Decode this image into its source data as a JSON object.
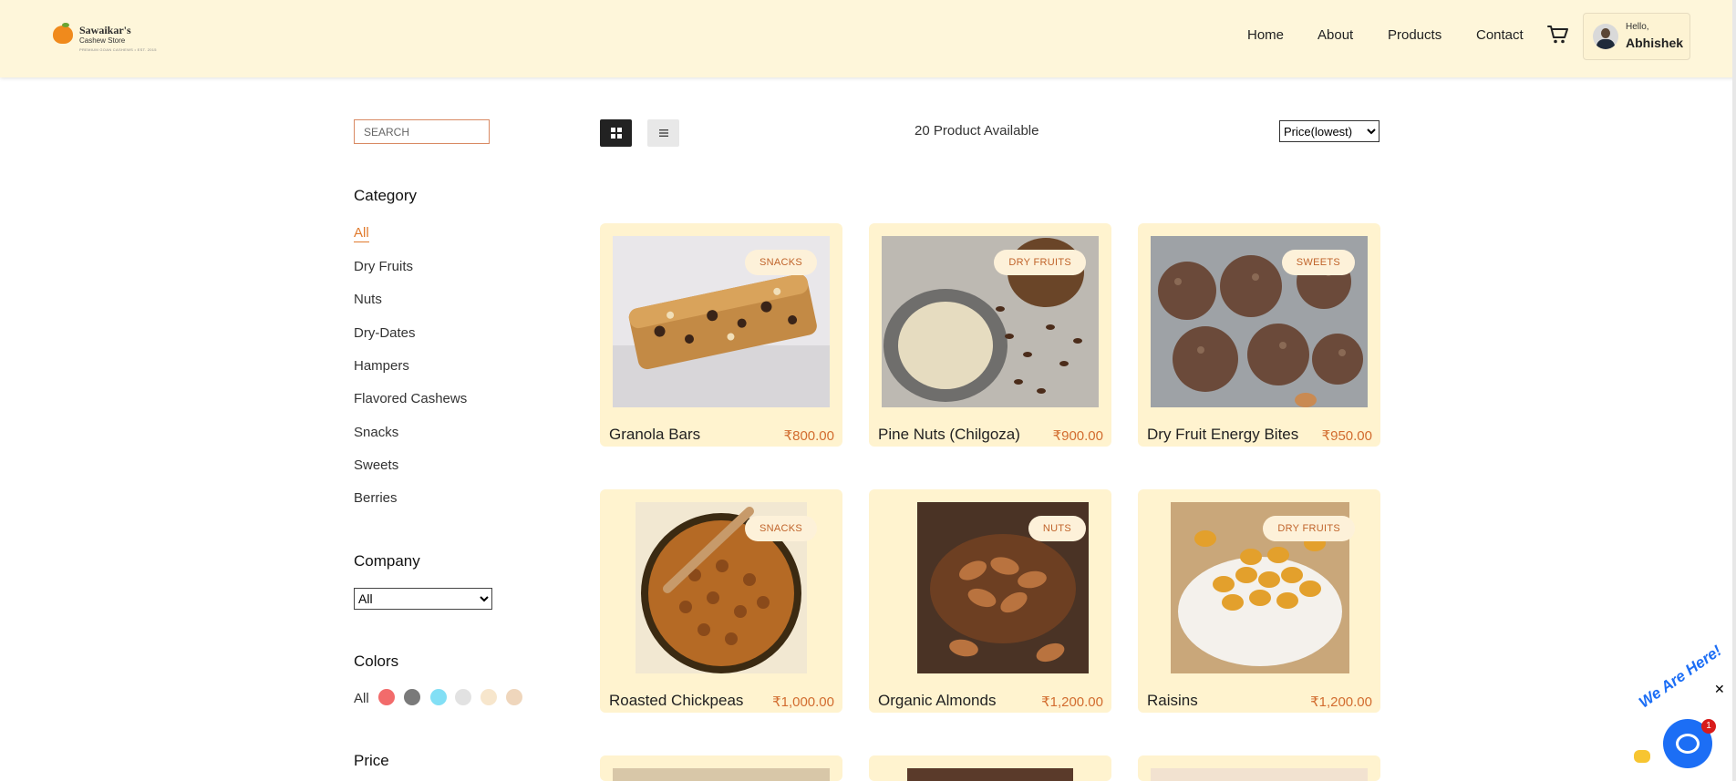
{
  "brand": {
    "name": "Sawaikar's",
    "sub": "Cashew Store",
    "tagline": "PREMIUM GOAN CASHEWS • EST. 2015"
  },
  "nav": {
    "home": "Home",
    "about": "About",
    "products": "Products",
    "contact": "Contact"
  },
  "user": {
    "greeting": "Hello,",
    "name": "Abhishek"
  },
  "filters": {
    "search_placeholder": "SEARCH",
    "category_title": "Category",
    "categories": [
      "All",
      "Dry Fruits",
      "Nuts",
      "Dry-Dates",
      "Hampers",
      "Flavored Cashews",
      "Snacks",
      "Sweets",
      "Berries"
    ],
    "company_title": "Company",
    "company_selected": "All",
    "colors_title": "Colors",
    "colors_all": "All",
    "colors": [
      "#f26b6b",
      "#7a7a7a",
      "#82dff5",
      "#e2e2e2",
      "#f7e6cc",
      "#efd6bc"
    ],
    "price_title": "Price"
  },
  "toolbar": {
    "count_text": "20 Product Available",
    "sort_selected": "Price(lowest)"
  },
  "products": [
    {
      "name": "Granola Bars",
      "price": "₹800.00",
      "category": "SNACKS"
    },
    {
      "name": "Pine Nuts (Chilgoza)",
      "price": "₹900.00",
      "category": "DRY FRUITS"
    },
    {
      "name": "Dry Fruit Energy Bites",
      "price": "₹950.00",
      "category": "SWEETS"
    },
    {
      "name": "Roasted Chickpeas",
      "price": "₹1,000.00",
      "category": "SNACKS"
    },
    {
      "name": "Organic Almonds",
      "price": "₹1,200.00",
      "category": "NUTS"
    },
    {
      "name": "Raisins",
      "price": "₹1,200.00",
      "category": "DRY FRUITS"
    }
  ],
  "chat": {
    "label": "We Are Here!",
    "badge": "1"
  }
}
